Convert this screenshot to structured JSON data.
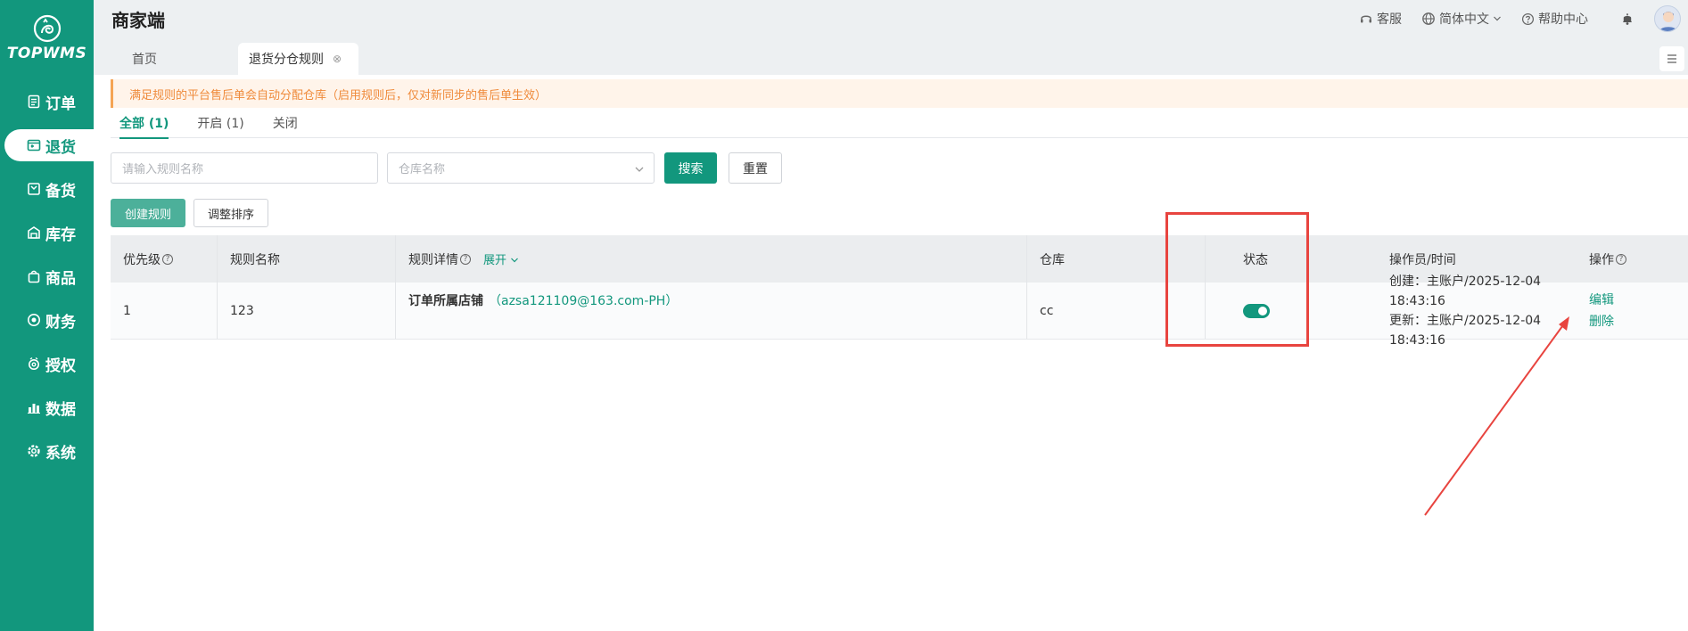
{
  "app": {
    "logo_text": "TOPWMS",
    "header_title": "商家端"
  },
  "header": {
    "service": "客服",
    "language": "简体中文",
    "help": "帮助中心"
  },
  "sidebar": {
    "items": [
      {
        "label": "订单",
        "icon": "order-icon"
      },
      {
        "label": "退货",
        "icon": "return-icon",
        "active": true
      },
      {
        "label": "备货",
        "icon": "stock-up-icon"
      },
      {
        "label": "库存",
        "icon": "inventory-icon"
      },
      {
        "label": "商品",
        "icon": "product-icon"
      },
      {
        "label": "财务",
        "icon": "finance-icon"
      },
      {
        "label": "授权",
        "icon": "auth-icon"
      },
      {
        "label": "数据",
        "icon": "data-icon"
      },
      {
        "label": "系统",
        "icon": "system-icon"
      }
    ]
  },
  "tabs": {
    "home": "首页",
    "active": "退货分仓规则"
  },
  "notice": "满足规则的平台售后单会自动分配仓库（启用规则后，仅对新同步的售后单生效）",
  "filter_tabs": [
    "全部 (1)",
    "开启 (1)",
    "关闭"
  ],
  "search": {
    "rule_name_placeholder": "请输入规则名称",
    "warehouse_placeholder": "仓库名称",
    "search_label": "搜索",
    "reset_label": "重置"
  },
  "actions": {
    "create_label": "创建规则",
    "reorder_label": "调整排序"
  },
  "table": {
    "headers": {
      "priority": "优先级",
      "rule_name": "规则名称",
      "rule_detail": "规则详情",
      "expand": "展开",
      "warehouse": "仓库",
      "status": "状态",
      "operator_time": "操作员/时间",
      "operation": "操作"
    },
    "rows": [
      {
        "priority": "1",
        "rule_name": "123",
        "detail_label": "订单所属店铺",
        "detail_value": "（azsa121109@163.com-PH）",
        "warehouse": "cc",
        "status_on": true,
        "created": "创建：主账户/2025-12-04 18:43:16",
        "updated": "更新：主账户/2025-12-04 18:43:16",
        "edit_label": "编辑",
        "delete_label": "删除"
      }
    ]
  },
  "colors": {
    "brand": "#12977d",
    "notice_text": "#ef8a3a",
    "annotation": "#e8443f"
  }
}
